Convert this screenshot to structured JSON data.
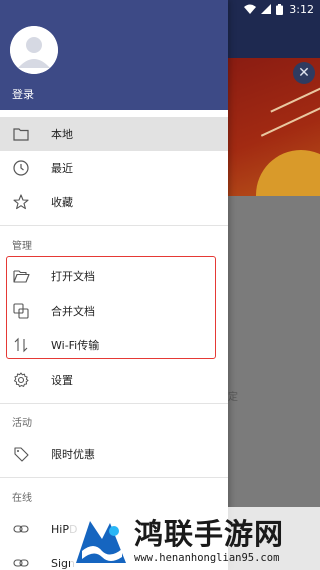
{
  "status_bar": {
    "time": "3:12"
  },
  "drawer": {
    "login_label": "登录",
    "items_primary": [
      {
        "label": "本地",
        "icon": "folder-icon",
        "selected": true
      },
      {
        "label": "最近",
        "icon": "clock-icon",
        "selected": false
      },
      {
        "label": "收藏",
        "icon": "star-icon",
        "selected": false
      }
    ],
    "section_manage": "管理",
    "items_manage": [
      {
        "label": "打开文档",
        "icon": "open-folder-icon"
      },
      {
        "label": "合并文档",
        "icon": "merge-icon"
      },
      {
        "label": "Wi-Fi传输",
        "icon": "transfer-icon"
      },
      {
        "label": "设置",
        "icon": "gear-icon"
      }
    ],
    "section_activity": "活动",
    "items_activity": [
      {
        "label": "限时优惠",
        "icon": "tag-icon"
      }
    ],
    "section_online": "在线",
    "items_online": [
      {
        "label": "HiPD",
        "icon": "link-icon"
      },
      {
        "label": "Sign",
        "icon": "link-icon"
      }
    ]
  },
  "background": {
    "partial_text": "定"
  },
  "watermark": {
    "title": "鸿联手游网",
    "url": "www.henanhonglian95.com"
  },
  "colors": {
    "header": "#3d4a86",
    "highlight": "#e53935",
    "selected_row": "#e2e2e2"
  }
}
